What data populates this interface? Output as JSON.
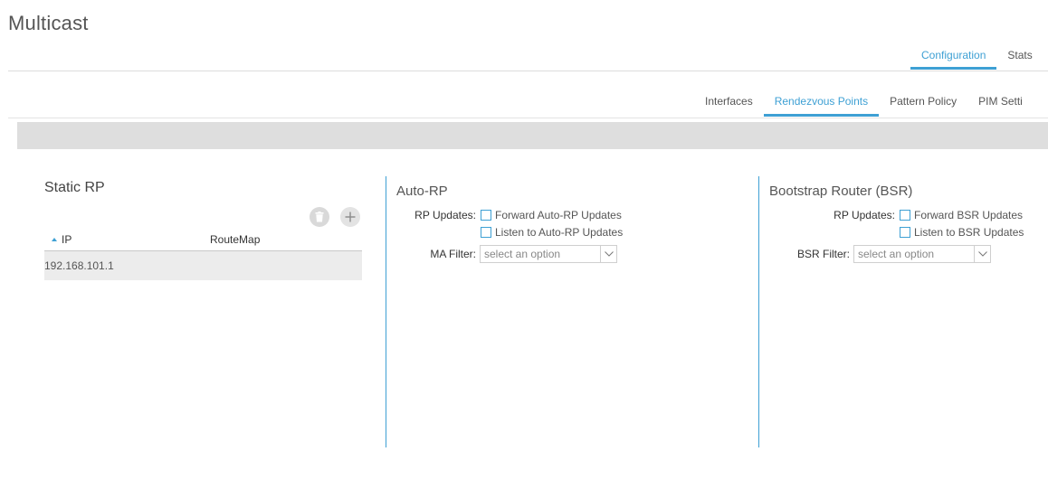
{
  "page": {
    "title": "Multicast"
  },
  "top_tabs": [
    {
      "label": "Configuration",
      "active": true
    },
    {
      "label": "Stats",
      "active": false
    }
  ],
  "sub_tabs": [
    {
      "label": "Interfaces",
      "active": false
    },
    {
      "label": "Rendezvous Points",
      "active": true
    },
    {
      "label": "Pattern Policy",
      "active": false
    },
    {
      "label": "PIM Setti",
      "active": false
    }
  ],
  "static_rp": {
    "title": "Static RP",
    "delete_icon": "trash-icon",
    "add_icon": "plus-icon",
    "columns": [
      "IP",
      "RouteMap"
    ],
    "rows": [
      {
        "ip": "192.168.101.1",
        "routemap": ""
      }
    ]
  },
  "auto_rp": {
    "title": "Auto-RP",
    "rp_updates_label": "RP Updates:",
    "forward_label": "Forward Auto-RP Updates",
    "listen_label": "Listen to Auto-RP Updates",
    "ma_filter_label": "MA Filter:",
    "ma_filter_placeholder": "select an option"
  },
  "bsr": {
    "title": "Bootstrap Router (BSR)",
    "rp_updates_label": "RP Updates:",
    "forward_label": "Forward BSR Updates",
    "listen_label": "Listen to BSR Updates",
    "bsr_filter_label": "BSR Filter:",
    "bsr_filter_placeholder": "select an option"
  },
  "colors": {
    "accent": "#3ea0d4",
    "band": "#dedede",
    "row": "#ececec"
  }
}
